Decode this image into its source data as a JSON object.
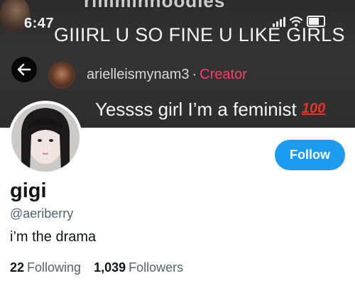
{
  "banner": {
    "status_time": "6:47",
    "cut_text": "rimminhoodies",
    "caption": "GIIIRL U SO FINE U LIKE GIRLS",
    "comment": {
      "username": "arielleismynam3",
      "separator": "·",
      "badge": "Creator",
      "text": "Yessss girl I’m a feminist",
      "emoji_text": "100",
      "badge_color": "#fe3c6c",
      "emoji_color": "#e8342c"
    }
  },
  "profile": {
    "display_name": "gigi",
    "handle": "@aeriberry",
    "bio": "i’m the drama",
    "following_count": "22",
    "following_label": "Following",
    "followers_count": "1,039",
    "followers_label": "Followers"
  },
  "actions": {
    "follow_label": "Follow",
    "follow_color": "#1d9bf0"
  },
  "icons": {
    "back": "back-arrow-icon",
    "signal": "signal-icon",
    "wifi": "wifi-icon",
    "battery": "battery-icon"
  }
}
